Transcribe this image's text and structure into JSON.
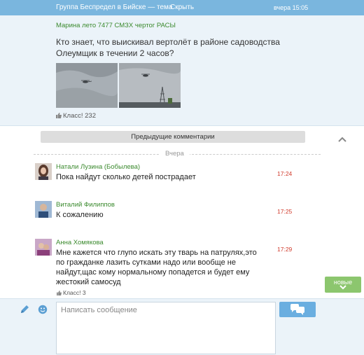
{
  "topbar": {
    "title": "Группа Беспредел в Бийске — тема",
    "hide_label": "Скрыть",
    "time": "вчера 15:05"
  },
  "post": {
    "author": "Марина лето 7477 СМЗХ чертог РАСЫ",
    "text": "Кто знает, что выискивал вертолёт в районе садоводства Олеумщик в течении 2 часов?",
    "likes": "Класс! 232"
  },
  "comments_section": {
    "prev_label": "Предыдущие комментарии",
    "day_label": "Вчера",
    "items": [
      {
        "author": "Натали Лузина (Бобылева)",
        "text": "Пока найдут сколько детей пострадает",
        "time": "17:24"
      },
      {
        "author": "Виталий Филиппов",
        "text": "К сожалению",
        "time": "17:25"
      },
      {
        "author": "Анна Хомякова",
        "text": "Мне кажется что глупо искать эту тварь на патрулях,это по гражданке лазить сутками надо или вообще не найдут,щас кому нормальному попадется и будет ему жестокий самосуд",
        "time": "17:29",
        "likes": "Класс! 3"
      }
    ],
    "new_label": "новые"
  },
  "composer": {
    "placeholder": "Написать сообщение"
  },
  "colors": {
    "topbar": "#7ab6de",
    "author_link": "#3b8a2e",
    "time_red": "#d03a2b",
    "new_button": "#8cc66e",
    "send_button": "#6aaee0"
  },
  "icons": {
    "like": "thumb-up-icon",
    "collapse": "chevron-up-icon",
    "new": "chevron-down-icon",
    "pencil": "pencil-icon",
    "smile": "smile-icon",
    "send": "chat-bubbles-icon"
  }
}
